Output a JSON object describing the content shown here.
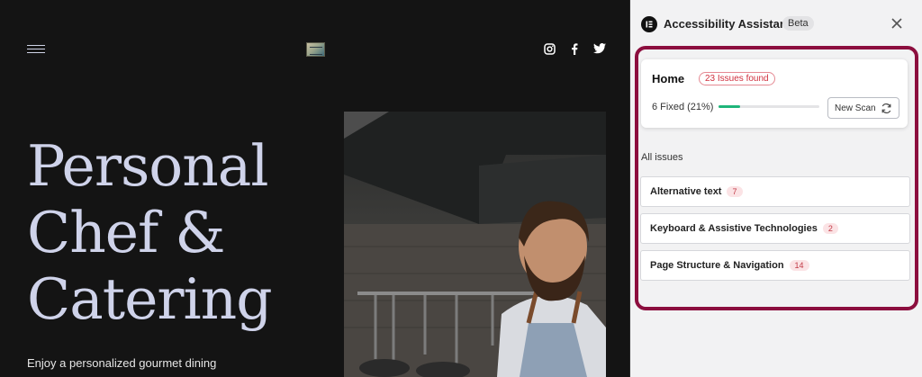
{
  "website": {
    "hero_title_lines": [
      "Personal",
      "Chef &",
      "Catering"
    ],
    "hero_subtitle": "Enjoy a personalized gourmet dining",
    "icons": [
      "menu-icon",
      "site-logo",
      "instagram-icon",
      "facebook-icon",
      "twitter-icon"
    ]
  },
  "panel": {
    "title": "Accessibility Assistant",
    "badge": "Beta",
    "summary": {
      "page_name": "Home",
      "issues_found": "23 Issues found",
      "fixed_text": "6 Fixed (21%)",
      "progress_fraction": 0.21,
      "new_scan_label": "New Scan"
    },
    "all_issues_label": "All issues",
    "issue_categories": [
      {
        "label": "Alternative text",
        "count": "7"
      },
      {
        "label": "Keyboard & Assistive Technologies",
        "count": "2"
      },
      {
        "label": "Page Structure & Navigation",
        "count": "14"
      }
    ]
  },
  "colors": {
    "site_background": "#141414",
    "hero_text": "#cfd3ea",
    "highlight_border": "#8c0e3e",
    "progress_fill": "#1fb57a",
    "error_red": "#d0303f"
  }
}
